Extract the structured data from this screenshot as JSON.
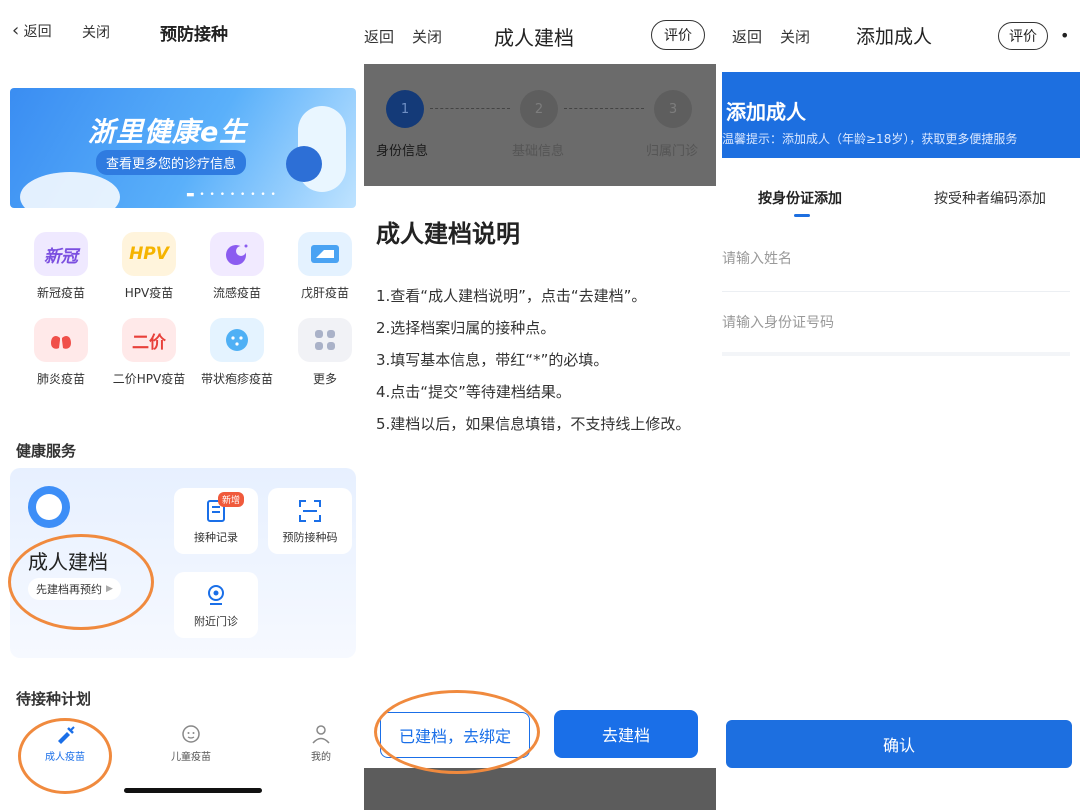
{
  "panel1": {
    "nav": {
      "back": "返回",
      "close": "关闭",
      "title": "预防接种"
    },
    "banner": {
      "title": "浙里健康e生",
      "subtitle": "查看更多您的诊疗信息"
    },
    "vaccines": [
      {
        "icon_text": "新冠",
        "label": "新冠疫苗"
      },
      {
        "icon_text": "HPV",
        "label": "HPV疫苗"
      },
      {
        "icon_text": "",
        "label": "流感疫苗"
      },
      {
        "icon_text": "",
        "label": "戊肝疫苗"
      },
      {
        "icon_text": "",
        "label": "肺炎疫苗"
      },
      {
        "icon_text": "二价",
        "label": "二价HPV疫苗"
      },
      {
        "icon_text": "",
        "label": "带状疱疹疫苗"
      },
      {
        "icon_text": "",
        "label": "更多"
      }
    ],
    "health_services": {
      "title": "健康服务",
      "main_label": "成人建档",
      "main_pill": "先建档再预约",
      "tiles": [
        {
          "label": "接种记录",
          "badge": "新增"
        },
        {
          "label": "预防接种码"
        },
        {
          "label": "附近门诊"
        }
      ]
    },
    "plan_title": "待接种计划",
    "tabbar": [
      {
        "label": "成人疫苗",
        "active": true
      },
      {
        "label": "儿童疫苗"
      },
      {
        "label": "我的"
      }
    ]
  },
  "panel2": {
    "nav": {
      "back": "返回",
      "close": "关闭",
      "title": "成人建档",
      "evaluate": "评价"
    },
    "steps": [
      {
        "num": "1",
        "label": "身份信息"
      },
      {
        "num": "2",
        "label": "基础信息"
      },
      {
        "num": "3",
        "label": "归属门诊"
      }
    ],
    "doc_title": "成人建档说明",
    "rules": [
      "1.查看“成人建档说明”，点击“去建档”。",
      "2.选择档案归属的接种点。",
      "3.填写基本信息，带红“*”的必填。",
      "4.点击“提交”等待建档结果。",
      "5.建档以后，如果信息填错，不支持线上修改。"
    ],
    "btn_bind": "已建档，去绑定",
    "btn_create": "去建档"
  },
  "panel3": {
    "nav": {
      "back": "返回",
      "close": "关闭",
      "title": "添加成人",
      "evaluate": "评价"
    },
    "head_title": "添加成人",
    "head_tip": "温馨提示：添加成人（年龄≥18岁），获取更多便捷服务",
    "tabs": [
      "按身份证添加",
      "按受种者编码添加"
    ],
    "name_placeholder": "请输入姓名",
    "id_placeholder": "请输入身份证号码",
    "confirm": "确认"
  },
  "colors": {
    "primary": "#1a6fe8",
    "highlight_ring": "#f08a3e"
  }
}
